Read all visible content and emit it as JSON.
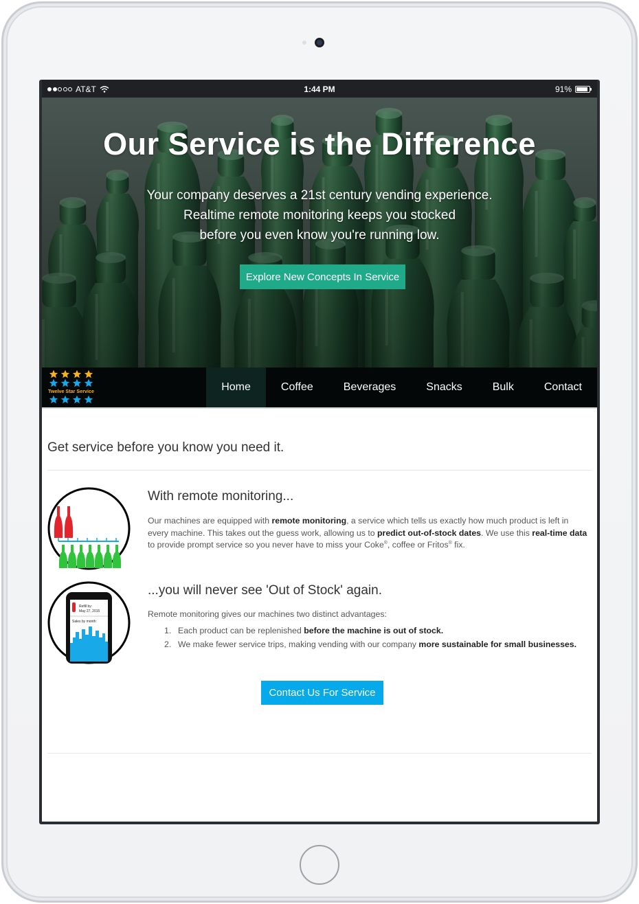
{
  "status_bar": {
    "carrier": "AT&T",
    "time": "1:44 PM",
    "battery": "91%",
    "battery_level": 0.91
  },
  "hero": {
    "title": "Our Service is the Difference",
    "subtitle_lines": [
      "Your company deserves a 21st century vending experience.",
      "Realtime remote monitoring keeps you stocked",
      "before you even know you're running low."
    ],
    "button_label": "Explore New Concepts In Service"
  },
  "logo": {
    "text": "Twelve Star Service",
    "colors": {
      "gold": "#f6b21a",
      "blue": "#17a9e8"
    }
  },
  "nav": {
    "items": [
      {
        "label": "Home",
        "active": true
      },
      {
        "label": "Coffee",
        "active": false
      },
      {
        "label": "Beverages",
        "active": false
      },
      {
        "label": "Snacks",
        "active": false
      },
      {
        "label": "Bulk",
        "active": false
      },
      {
        "label": "Contact",
        "active": false
      }
    ]
  },
  "main": {
    "tagline": "Get service before you know you need it.",
    "feature1": {
      "title": "With remote monitoring...",
      "body": [
        {
          "t": "Our machines are equipped with ",
          "b": false
        },
        {
          "t": "remote monitoring",
          "b": true
        },
        {
          "t": ", a service which tells us exactly how much product is left in every machine. This takes out the guess work, allowing us to ",
          "b": false
        },
        {
          "t": "predict out-of-stock dates",
          "b": true
        },
        {
          "t": ". We use this ",
          "b": false
        },
        {
          "t": "real-time data",
          "b": true
        },
        {
          "t": " to provide prompt service so you never have to miss your Coke",
          "b": false
        },
        {
          "t": "®",
          "b": false,
          "sup": true
        },
        {
          "t": ", coffee or Fritos",
          "b": false
        },
        {
          "t": "®",
          "b": false,
          "sup": true
        },
        {
          "t": " fix.",
          "b": false
        }
      ]
    },
    "feature2": {
      "title": "...you will never see 'Out of Stock' again.",
      "intro": "Remote monitoring gives our machines two distinct advantages:",
      "list": [
        {
          "num": "1.",
          "text": "Each product can be replenished ",
          "bold": "before the machine is out of stock."
        },
        {
          "num": "2.",
          "text": "We make fewer service trips, making vending with our company ",
          "bold": "more sustainable for small businesses."
        }
      ],
      "phone": {
        "refill_label": "Refill by:",
        "refill_date": "May 27, 2015",
        "sales_label": "Sales by month:"
      }
    },
    "contact_button": "Contact Us For Service"
  },
  "colors": {
    "hero_button": "#1faa8a",
    "contact_button": "#06a9ea",
    "nav_bg": "#040707",
    "nav_active": "#0e2421",
    "bottle_red": "#e0262c",
    "bottle_green": "#2fc43c",
    "phone_blue": "#17a9e8"
  }
}
